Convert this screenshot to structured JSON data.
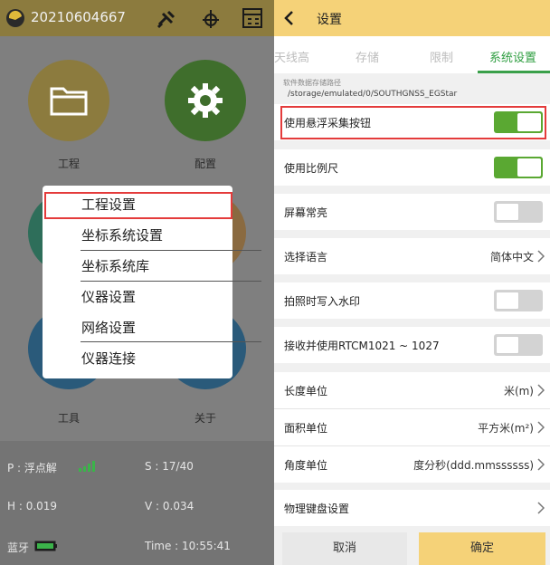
{
  "left": {
    "project_title": "20210604667",
    "icons": [
      "logo-icon",
      "satellite-icon",
      "target-icon",
      "calculator-icon"
    ],
    "tiles": [
      {
        "label": "工程",
        "color": "#8c7b3e",
        "icon": "folder-icon"
      },
      {
        "label": "配置",
        "color": "#3f6e2c",
        "icon": "gear-icon"
      },
      {
        "label": "工具",
        "color": "#2a5a7a"
      },
      {
        "label": "关于",
        "color": "#2a5a7a"
      }
    ],
    "menu": {
      "items": [
        "工程设置",
        "坐标系统设置",
        "坐标系统库",
        "仪器设置",
        "网络设置",
        "仪器连接"
      ]
    },
    "status": {
      "solution": "P : 浮点解",
      "satellites": "S : 17/40",
      "h": "H : 0.019",
      "v": "V : 0.034",
      "bluetooth": "蓝牙",
      "time": "Time : 10:55:41"
    }
  },
  "right": {
    "title": "设置",
    "tabs": [
      "天线高",
      "存储",
      "限制",
      "系统设置"
    ],
    "active_tab": 3,
    "path_label": "软件数据存储路径",
    "path": "/storage/emulated/0/SOUTHGNSS_EGStar",
    "rows": [
      {
        "label": "使用悬浮采集按钮",
        "toggle": "on"
      },
      {
        "label": "使用比例尺",
        "toggle": "on"
      },
      {
        "label": "屏幕常亮",
        "toggle": "off"
      },
      {
        "label": "选择语言",
        "value": "简体中文"
      },
      {
        "label": "拍照时写入水印",
        "toggle": "off"
      },
      {
        "label": "接收并使用RTCM1021 ~ 1027",
        "toggle": "off"
      },
      {
        "label": "长度单位",
        "value": "米(m)"
      },
      {
        "label": "面积单位",
        "value": "平方米(m²)"
      },
      {
        "label": "角度单位",
        "value": "度分秒(ddd.mmssssss)"
      },
      {
        "label": "物理键盘设置",
        "value": ""
      }
    ],
    "buttons": {
      "cancel": "取消",
      "ok": "确定"
    }
  },
  "colors": {
    "accent": "#f5d278",
    "active_tab": "#2f9e41",
    "toggle_on": "#5aa832",
    "highlight": "#e43b3b"
  }
}
